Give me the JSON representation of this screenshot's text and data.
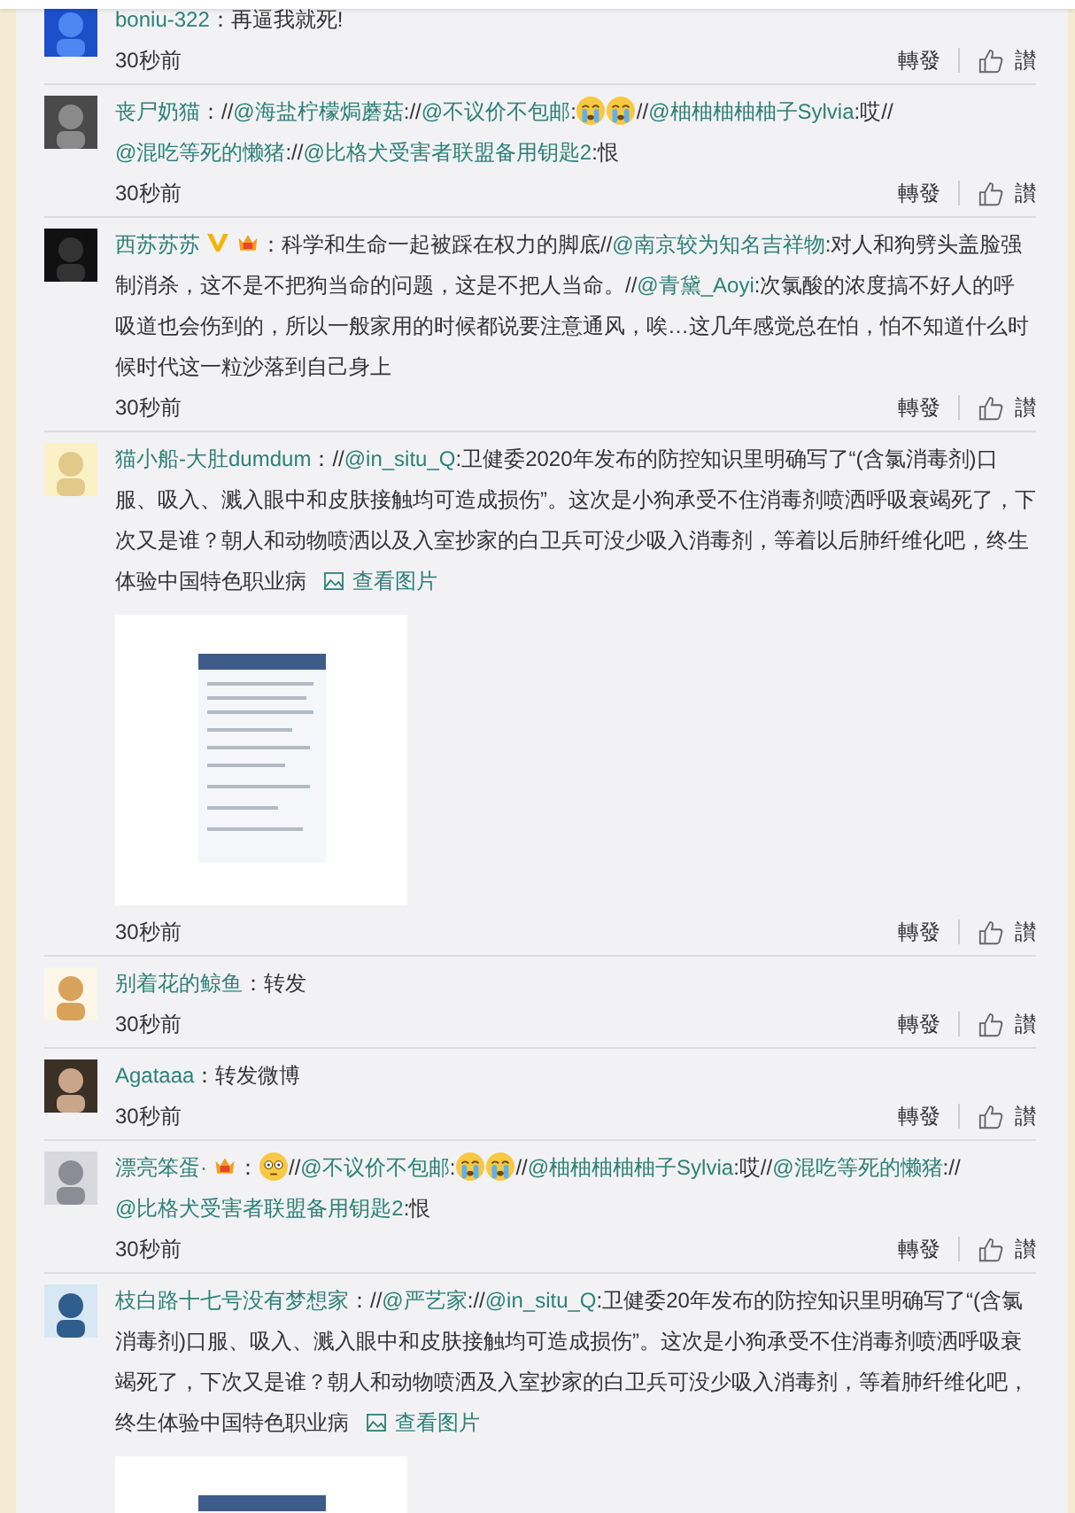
{
  "comments": [
    {
      "name": "boniu-322",
      "verified": false,
      "member": false,
      "segments": [
        {
          "kind": "text",
          "text": "：再逼我就死!"
        }
      ],
      "time": "30秒前",
      "forward": "轉發",
      "like": "讃"
    },
    {
      "name": "丧尸奶猫",
      "verified": false,
      "member": false,
      "segments": [
        {
          "kind": "text",
          "text": "：//"
        },
        {
          "kind": "mention",
          "text": "@海盐柠檬焗蘑菇"
        },
        {
          "kind": "text",
          "text": "://"
        },
        {
          "kind": "mention",
          "text": "@不议价不包邮"
        },
        {
          "kind": "text",
          "text": ":"
        },
        {
          "kind": "cry"
        },
        {
          "kind": "cry"
        },
        {
          "kind": "text",
          "text": "//"
        },
        {
          "kind": "mention",
          "text": "@柚柚柚柚柚子Sylvia"
        },
        {
          "kind": "text",
          "text": ":哎//"
        },
        {
          "kind": "mention",
          "text": "@混吃等死的懒猪"
        },
        {
          "kind": "text",
          "text": "://"
        },
        {
          "kind": "mention",
          "text": "@比格犬受害者联盟备用钥匙2"
        },
        {
          "kind": "text",
          "text": ":恨"
        }
      ],
      "time": "30秒前",
      "forward": "轉發",
      "like": "讃"
    },
    {
      "name": "西苏苏苏",
      "verified": true,
      "member": true,
      "segments": [
        {
          "kind": "text",
          "text": "：科学和生命一起被踩在权力的脚底//"
        },
        {
          "kind": "mention",
          "text": "@南京较为知名吉祥物"
        },
        {
          "kind": "text",
          "text": ":对人和狗劈头盖脸强制消杀，这不是不把狗当命的问题，这是不把人当命。//"
        },
        {
          "kind": "mention",
          "text": "@青黛_Aoyi"
        },
        {
          "kind": "text",
          "text": ":次氯酸的浓度搞不好人的呼吸道也会伤到的，所以一般家用的时候都说要注意通风，唉…这几年感觉总在怕，怕不知道什么时候时代这一粒沙落到自己身上"
        }
      ],
      "time": "30秒前",
      "forward": "轉發",
      "like": "讃"
    },
    {
      "name": "猫小船-大肚dumdum",
      "verified": false,
      "member": false,
      "segments": [
        {
          "kind": "text",
          "text": "：//"
        },
        {
          "kind": "mention",
          "text": "@in_situ_Q"
        },
        {
          "kind": "text",
          "text": ":卫健委2020年发布的防控知识里明确写了“(含氯消毒剂)口服、吸入、溅入眼中和皮肤接触均可造成损伤”。这次是小狗承受不住消毒剂喷洒呼吸衰竭死了，下次又是谁？朝人和动物喷洒以及入室抄家的白卫兵可没少吸入消毒剂，等着以后肺纤维化吧，终生体验中国特色职业病"
        }
      ],
      "view_image": "查看图片",
      "time": "30秒前",
      "forward": "轉發",
      "like": "讃"
    },
    {
      "name": "别着花的鲸鱼",
      "verified": false,
      "member": false,
      "segments": [
        {
          "kind": "text",
          "text": "：转发"
        }
      ],
      "time": "30秒前",
      "forward": "轉發",
      "like": "讃"
    },
    {
      "name": "Agataaa",
      "verified": false,
      "member": false,
      "segments": [
        {
          "kind": "text",
          "text": "：转发微博"
        }
      ],
      "time": "30秒前",
      "forward": "轉發",
      "like": "讃"
    },
    {
      "name": "漂亮笨蛋·",
      "verified": false,
      "member": true,
      "segments": [
        {
          "kind": "text",
          "text": "："
        },
        {
          "kind": "stare"
        },
        {
          "kind": "text",
          "text": "//"
        },
        {
          "kind": "mention",
          "text": "@不议价不包邮"
        },
        {
          "kind": "text",
          "text": ":"
        },
        {
          "kind": "cry"
        },
        {
          "kind": "cry"
        },
        {
          "kind": "text",
          "text": "//"
        },
        {
          "kind": "mention",
          "text": "@柚柚柚柚柚子Sylvia"
        },
        {
          "kind": "text",
          "text": ":哎//"
        },
        {
          "kind": "mention",
          "text": "@混吃等死的懒猪"
        },
        {
          "kind": "text",
          "text": "://"
        },
        {
          "kind": "mention",
          "text": "@比格犬受害者联盟备用钥匙2"
        },
        {
          "kind": "text",
          "text": ":恨"
        }
      ],
      "time": "30秒前",
      "forward": "轉發",
      "like": "讃"
    },
    {
      "name": "枝白路十七号没有梦想家",
      "verified": false,
      "member": false,
      "segments": [
        {
          "kind": "text",
          "text": "：//"
        },
        {
          "kind": "mention",
          "text": "@严艺家"
        },
        {
          "kind": "text",
          "text": "://"
        },
        {
          "kind": "mention",
          "text": "@in_situ_Q"
        },
        {
          "kind": "text",
          "text": ":卫健委20年发布的防控知识里明确写了“(含氯消毒剂)口服、吸入、溅入眼中和皮肤接触均可造成损伤”。这次是小狗承受不住消毒剂喷洒呼吸衰竭死了，下次又是谁？朝人和动物喷洒及入室抄家的白卫兵可没少吸入消毒剂，等着肺纤维化吧，终生体验中国特色职业病"
        }
      ],
      "view_image": "查看图片"
    }
  ]
}
